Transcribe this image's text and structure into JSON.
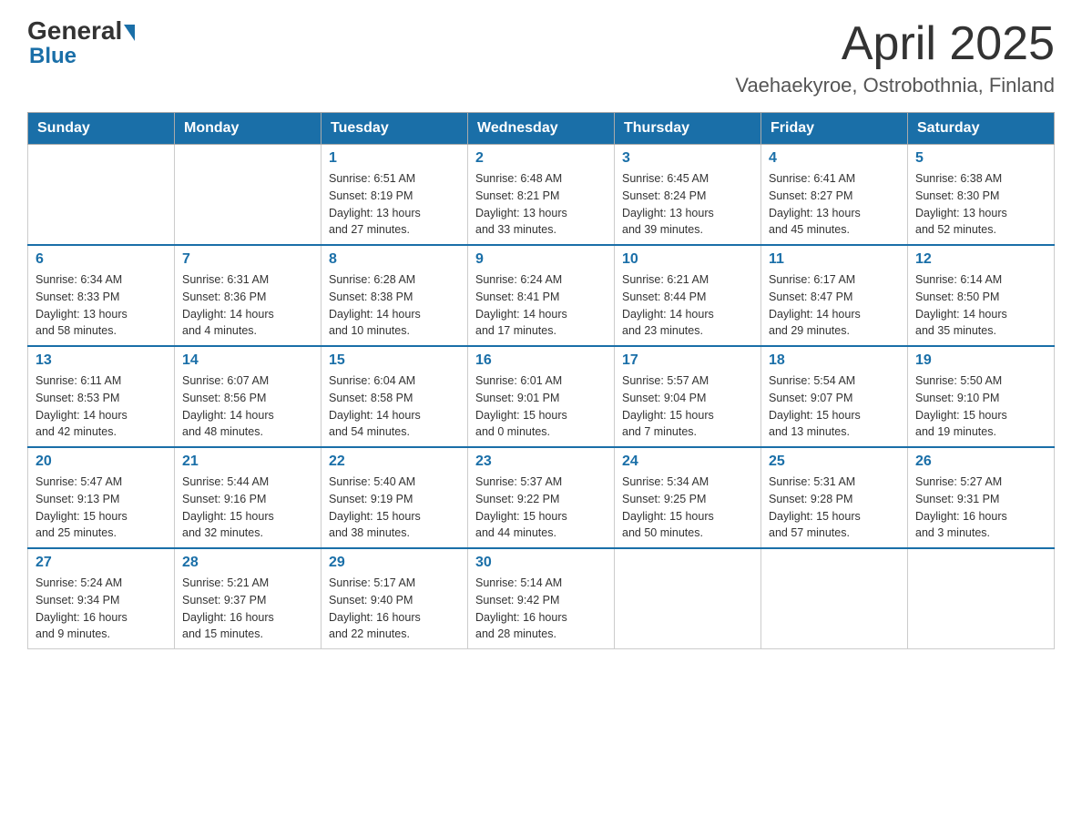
{
  "header": {
    "logo": {
      "general": "General",
      "blue": "Blue"
    },
    "title": "April 2025",
    "location": "Vaehaekyroe, Ostrobothnia, Finland"
  },
  "days_of_week": [
    "Sunday",
    "Monday",
    "Tuesday",
    "Wednesday",
    "Thursday",
    "Friday",
    "Saturday"
  ],
  "weeks": [
    [
      {
        "day": "",
        "info": ""
      },
      {
        "day": "",
        "info": ""
      },
      {
        "day": "1",
        "info": "Sunrise: 6:51 AM\nSunset: 8:19 PM\nDaylight: 13 hours\nand 27 minutes."
      },
      {
        "day": "2",
        "info": "Sunrise: 6:48 AM\nSunset: 8:21 PM\nDaylight: 13 hours\nand 33 minutes."
      },
      {
        "day": "3",
        "info": "Sunrise: 6:45 AM\nSunset: 8:24 PM\nDaylight: 13 hours\nand 39 minutes."
      },
      {
        "day": "4",
        "info": "Sunrise: 6:41 AM\nSunset: 8:27 PM\nDaylight: 13 hours\nand 45 minutes."
      },
      {
        "day": "5",
        "info": "Sunrise: 6:38 AM\nSunset: 8:30 PM\nDaylight: 13 hours\nand 52 minutes."
      }
    ],
    [
      {
        "day": "6",
        "info": "Sunrise: 6:34 AM\nSunset: 8:33 PM\nDaylight: 13 hours\nand 58 minutes."
      },
      {
        "day": "7",
        "info": "Sunrise: 6:31 AM\nSunset: 8:36 PM\nDaylight: 14 hours\nand 4 minutes."
      },
      {
        "day": "8",
        "info": "Sunrise: 6:28 AM\nSunset: 8:38 PM\nDaylight: 14 hours\nand 10 minutes."
      },
      {
        "day": "9",
        "info": "Sunrise: 6:24 AM\nSunset: 8:41 PM\nDaylight: 14 hours\nand 17 minutes."
      },
      {
        "day": "10",
        "info": "Sunrise: 6:21 AM\nSunset: 8:44 PM\nDaylight: 14 hours\nand 23 minutes."
      },
      {
        "day": "11",
        "info": "Sunrise: 6:17 AM\nSunset: 8:47 PM\nDaylight: 14 hours\nand 29 minutes."
      },
      {
        "day": "12",
        "info": "Sunrise: 6:14 AM\nSunset: 8:50 PM\nDaylight: 14 hours\nand 35 minutes."
      }
    ],
    [
      {
        "day": "13",
        "info": "Sunrise: 6:11 AM\nSunset: 8:53 PM\nDaylight: 14 hours\nand 42 minutes."
      },
      {
        "day": "14",
        "info": "Sunrise: 6:07 AM\nSunset: 8:56 PM\nDaylight: 14 hours\nand 48 minutes."
      },
      {
        "day": "15",
        "info": "Sunrise: 6:04 AM\nSunset: 8:58 PM\nDaylight: 14 hours\nand 54 minutes."
      },
      {
        "day": "16",
        "info": "Sunrise: 6:01 AM\nSunset: 9:01 PM\nDaylight: 15 hours\nand 0 minutes."
      },
      {
        "day": "17",
        "info": "Sunrise: 5:57 AM\nSunset: 9:04 PM\nDaylight: 15 hours\nand 7 minutes."
      },
      {
        "day": "18",
        "info": "Sunrise: 5:54 AM\nSunset: 9:07 PM\nDaylight: 15 hours\nand 13 minutes."
      },
      {
        "day": "19",
        "info": "Sunrise: 5:50 AM\nSunset: 9:10 PM\nDaylight: 15 hours\nand 19 minutes."
      }
    ],
    [
      {
        "day": "20",
        "info": "Sunrise: 5:47 AM\nSunset: 9:13 PM\nDaylight: 15 hours\nand 25 minutes."
      },
      {
        "day": "21",
        "info": "Sunrise: 5:44 AM\nSunset: 9:16 PM\nDaylight: 15 hours\nand 32 minutes."
      },
      {
        "day": "22",
        "info": "Sunrise: 5:40 AM\nSunset: 9:19 PM\nDaylight: 15 hours\nand 38 minutes."
      },
      {
        "day": "23",
        "info": "Sunrise: 5:37 AM\nSunset: 9:22 PM\nDaylight: 15 hours\nand 44 minutes."
      },
      {
        "day": "24",
        "info": "Sunrise: 5:34 AM\nSunset: 9:25 PM\nDaylight: 15 hours\nand 50 minutes."
      },
      {
        "day": "25",
        "info": "Sunrise: 5:31 AM\nSunset: 9:28 PM\nDaylight: 15 hours\nand 57 minutes."
      },
      {
        "day": "26",
        "info": "Sunrise: 5:27 AM\nSunset: 9:31 PM\nDaylight: 16 hours\nand 3 minutes."
      }
    ],
    [
      {
        "day": "27",
        "info": "Sunrise: 5:24 AM\nSunset: 9:34 PM\nDaylight: 16 hours\nand 9 minutes."
      },
      {
        "day": "28",
        "info": "Sunrise: 5:21 AM\nSunset: 9:37 PM\nDaylight: 16 hours\nand 15 minutes."
      },
      {
        "day": "29",
        "info": "Sunrise: 5:17 AM\nSunset: 9:40 PM\nDaylight: 16 hours\nand 22 minutes."
      },
      {
        "day": "30",
        "info": "Sunrise: 5:14 AM\nSunset: 9:42 PM\nDaylight: 16 hours\nand 28 minutes."
      },
      {
        "day": "",
        "info": ""
      },
      {
        "day": "",
        "info": ""
      },
      {
        "day": "",
        "info": ""
      }
    ]
  ]
}
